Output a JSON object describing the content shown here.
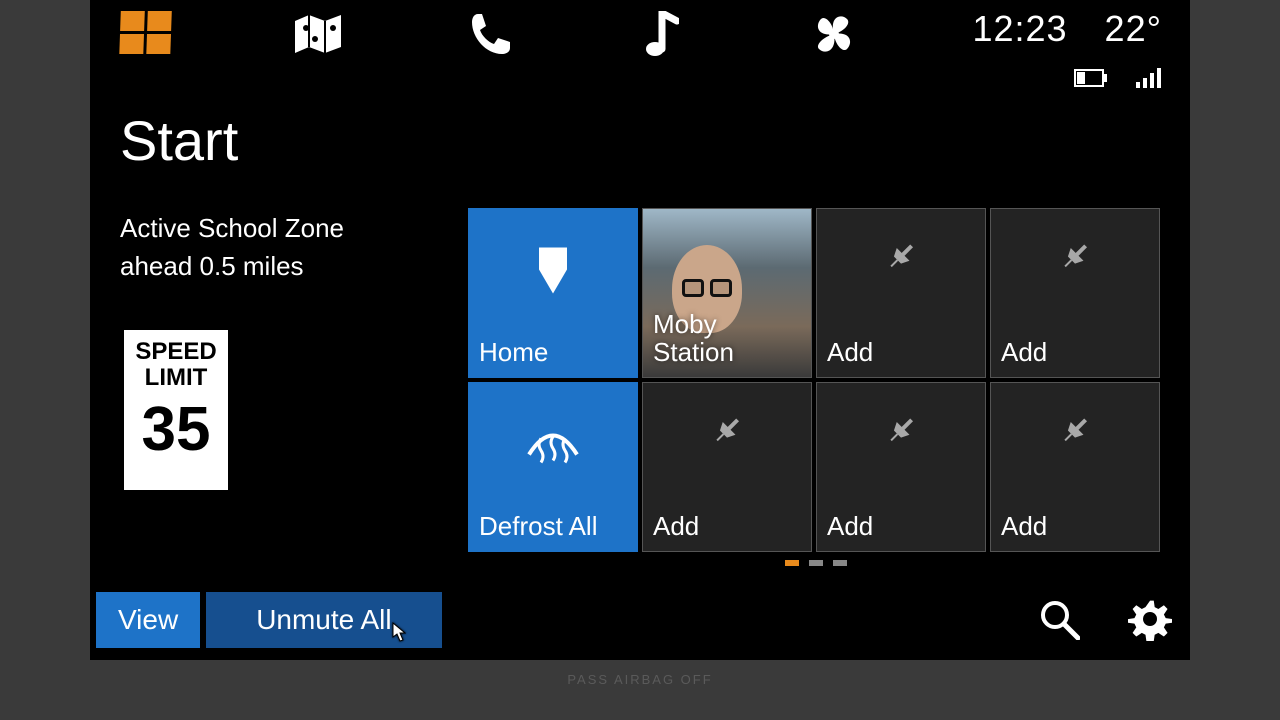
{
  "status": {
    "time": "12:23",
    "temperature": "22°"
  },
  "page_title": "Start",
  "alert": {
    "line1": "Active School Zone",
    "line2": "ahead 0.5 miles"
  },
  "speed_sign": {
    "line1": "SPEED",
    "line2": "LIMIT",
    "value": "35"
  },
  "tiles": {
    "home": "Home",
    "moby": "Moby\nStation",
    "defrost": "Defrost All",
    "add": "Add"
  },
  "buttons": {
    "view": "View",
    "unmute": "Unmute All"
  },
  "footer": "PASS AIRBAG OFF",
  "nav_icons": {
    "start": "windows-start-icon",
    "map": "map-icon",
    "phone": "phone-icon",
    "music": "music-icon",
    "climate": "fan-icon"
  }
}
